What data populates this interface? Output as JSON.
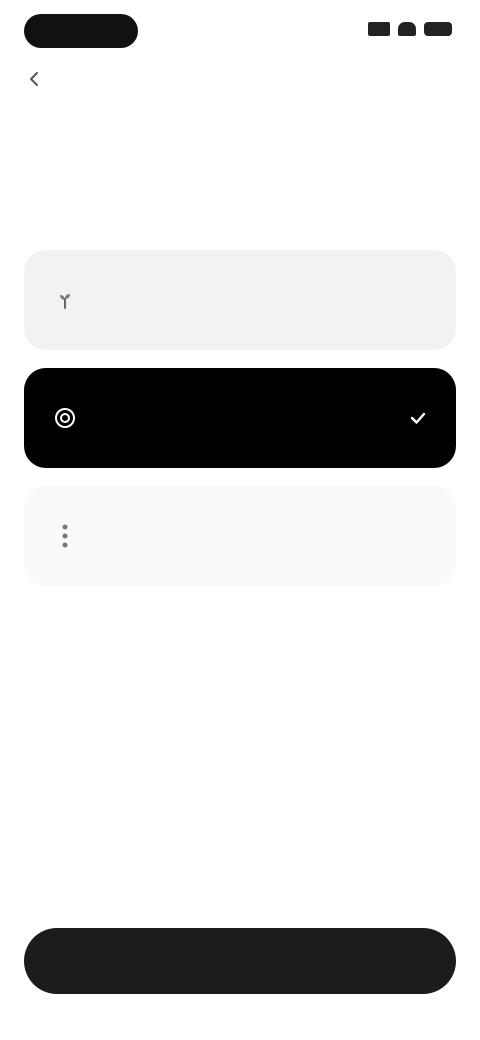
{
  "header": {
    "back_label": ""
  },
  "title": "",
  "options": [
    {
      "title": "",
      "description": "",
      "selected": false,
      "icon": "sprout-icon"
    },
    {
      "title": "",
      "description": "",
      "selected": true,
      "icon": "target-icon"
    },
    {
      "title": "",
      "description": "",
      "selected": false,
      "icon": "grip-icon"
    }
  ],
  "footer": {
    "continue_label": ""
  },
  "colors": {
    "selected_card": "#000000",
    "unselected_card": "#f2f2f2",
    "button": "#1c1c1c"
  }
}
